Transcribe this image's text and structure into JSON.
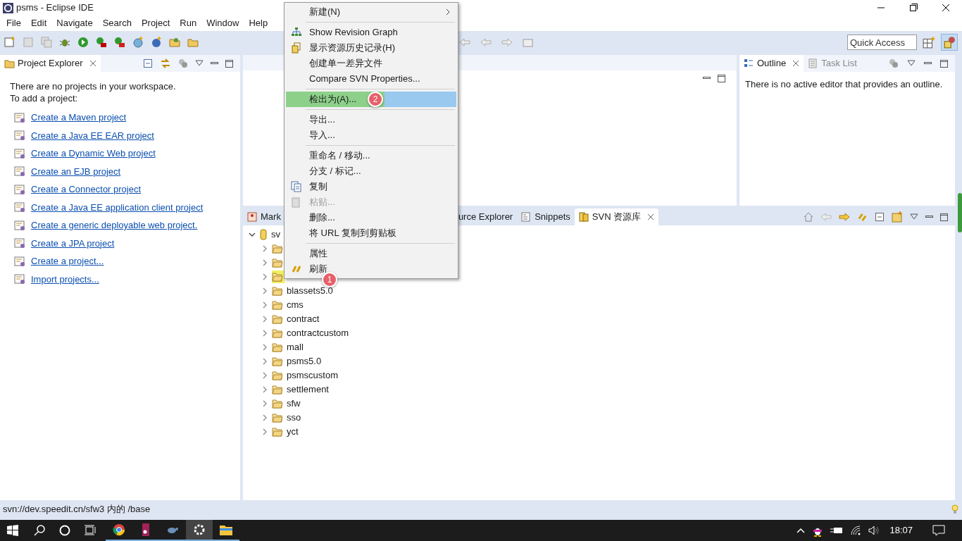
{
  "window": {
    "title": "psms - Eclipse IDE"
  },
  "menubar": [
    "File",
    "Edit",
    "Navigate",
    "Search",
    "Project",
    "Run",
    "Window",
    "Help"
  ],
  "quick_access": {
    "placeholder": "Quick Access"
  },
  "project_explorer": {
    "tab": "Project Explorer",
    "intro": [
      "There are no projects in your workspace.",
      "To add a project:"
    ],
    "links": [
      "Create a Maven project",
      "Create a Java EE EAR project",
      "Create a Dynamic Web project",
      "Create an EJB project",
      "Create a Connector project",
      "Create a Java EE application client project",
      "Create a generic deployable web project.",
      "Create a JPA project",
      "Create a project...",
      "Import projects..."
    ]
  },
  "outline": {
    "tabs": [
      {
        "label": "Outline",
        "selected": true
      },
      {
        "label": "Task List",
        "selected": false
      }
    ],
    "message": "There is no active editor that provides an outline."
  },
  "bottom_panel": {
    "tabs": [
      {
        "label": "Mark",
        "selected": false
      },
      {
        "label": "urce Explorer",
        "selected": false
      },
      {
        "label": "Snippets",
        "selected": false
      },
      {
        "label": "SVN 资源库",
        "selected": true
      }
    ],
    "tree": [
      {
        "label": "sv",
        "expanded": true,
        "kind": "repo",
        "children": [
          {
            "expanded": false,
            "kind": "folder",
            "highlighted": false
          },
          {
            "expanded": false,
            "kind": "folder",
            "highlighted": false
          },
          {
            "expanded": false,
            "kind": "folder",
            "highlighted": true
          },
          {
            "label": "blassets5.0",
            "expanded": false,
            "kind": "folder",
            "highlighted": false
          },
          {
            "label": "cms",
            "expanded": false,
            "kind": "folder",
            "highlighted": false
          },
          {
            "label": "contract",
            "expanded": false,
            "kind": "folder",
            "highlighted": false
          },
          {
            "label": "contractcustom",
            "expanded": false,
            "kind": "folder",
            "highlighted": false
          },
          {
            "label": "mall",
            "expanded": false,
            "kind": "folder",
            "highlighted": false
          },
          {
            "label": "psms5.0",
            "expanded": false,
            "kind": "folder",
            "highlighted": false
          },
          {
            "label": "psmscustom",
            "expanded": false,
            "kind": "folder",
            "highlighted": false
          },
          {
            "label": "settlement",
            "expanded": false,
            "kind": "folder",
            "highlighted": false
          },
          {
            "label": "sfw",
            "expanded": false,
            "kind": "folder",
            "highlighted": false
          },
          {
            "label": "sso",
            "expanded": false,
            "kind": "folder",
            "highlighted": false
          },
          {
            "label": "yct",
            "expanded": false,
            "kind": "folder",
            "highlighted": false
          }
        ]
      }
    ]
  },
  "context_menu": [
    {
      "kind": "item",
      "label": "新建(N)",
      "submenu": true,
      "selected": false,
      "disabled": false
    },
    {
      "kind": "separator"
    },
    {
      "kind": "item",
      "label": "Show Revision Graph",
      "submenu": false,
      "selected": false,
      "disabled": false
    },
    {
      "kind": "item",
      "label": "显示资源历史记录(H)",
      "submenu": false,
      "selected": false,
      "disabled": false
    },
    {
      "kind": "item",
      "label": "创建单一差异文件",
      "submenu": false,
      "selected": false,
      "disabled": false
    },
    {
      "kind": "item",
      "label": "Compare SVN Properties...",
      "submenu": false,
      "selected": false,
      "disabled": false
    },
    {
      "kind": "separator"
    },
    {
      "kind": "item",
      "label": "检出为(A)...",
      "submenu": false,
      "selected": true,
      "disabled": false,
      "badge": "2"
    },
    {
      "kind": "separator"
    },
    {
      "kind": "item",
      "label": "导出...",
      "submenu": false,
      "selected": false,
      "disabled": false
    },
    {
      "kind": "item",
      "label": "导入...",
      "submenu": false,
      "selected": false,
      "disabled": false
    },
    {
      "kind": "separator"
    },
    {
      "kind": "item",
      "label": "重命名 / 移动...",
      "submenu": false,
      "selected": false,
      "disabled": false
    },
    {
      "kind": "item",
      "label": "分支 / 标记...",
      "submenu": false,
      "selected": false,
      "disabled": false
    },
    {
      "kind": "item",
      "label": "复制",
      "submenu": false,
      "selected": false,
      "disabled": false
    },
    {
      "kind": "item",
      "label": "粘贴...",
      "submenu": false,
      "selected": false,
      "disabled": true
    },
    {
      "kind": "item",
      "label": "删除...",
      "submenu": false,
      "selected": false,
      "disabled": false
    },
    {
      "kind": "item",
      "label": "将 URL 复制到剪贴板",
      "submenu": false,
      "selected": false,
      "disabled": false
    },
    {
      "kind": "separator"
    },
    {
      "kind": "item",
      "label": "属性",
      "submenu": false,
      "selected": false,
      "disabled": false
    },
    {
      "kind": "item",
      "label": "刷新",
      "submenu": false,
      "selected": false,
      "disabled": false,
      "badge": "1"
    }
  ],
  "status_bar": "svn://dev.speedit.cn/sfw3 内的 /base",
  "taskbar": {
    "clock": "18:07"
  }
}
